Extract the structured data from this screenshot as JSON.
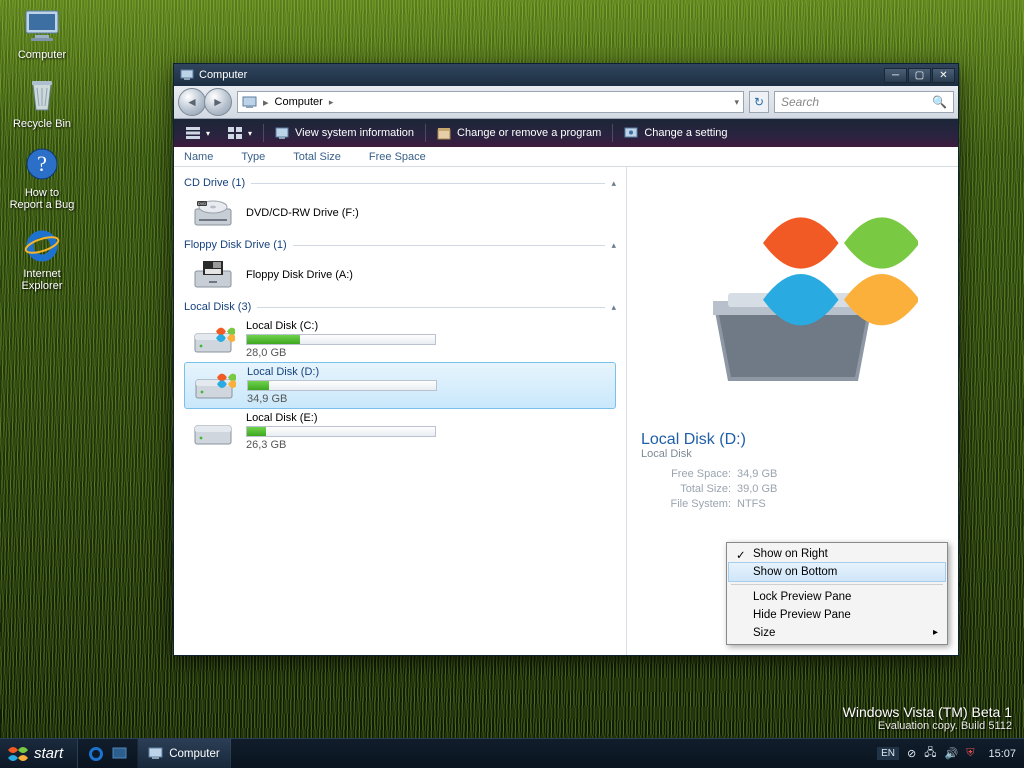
{
  "desktop": {
    "icons": [
      {
        "name": "computer-icon",
        "label": "Computer"
      },
      {
        "name": "recycle-bin-icon",
        "label": "Recycle Bin"
      },
      {
        "name": "help-icon",
        "label": "How to\nReport a Bug"
      },
      {
        "name": "ie-icon",
        "label": "Internet\nExplorer"
      }
    ]
  },
  "window": {
    "title": "Computer",
    "nav": {
      "back": "Back",
      "forward": "Forward"
    },
    "breadcrumb": {
      "crumb0": "Computer"
    },
    "search": {
      "placeholder": "Search"
    },
    "commands": {
      "organize_icon_label": "Organize",
      "views_icon_label": "Views",
      "view_system_info": "View system information",
      "change_remove": "Change or remove a program",
      "change_setting": "Change a setting"
    },
    "columns": {
      "c0": "Name",
      "c1": "Type",
      "c2": "Total Size",
      "c3": "Free Space"
    },
    "groups": {
      "cd_label": "CD Drive (1)",
      "cd_item_label": "DVD/CD-RW Drive (F:)",
      "floppy_label": "Floppy Disk Drive (1)",
      "floppy_item_label": "Floppy Disk Drive (A:)",
      "local_label": "Local Disk (3)",
      "disks": [
        {
          "name": "Local Disk (C:)",
          "cap": "28,0 GB",
          "fill": 28
        },
        {
          "name": "Local Disk (D:)",
          "cap": "34,9 GB",
          "fill": 11,
          "selected": true
        },
        {
          "name": "Local Disk (E:)",
          "cap": "26,3 GB",
          "fill": 10
        }
      ]
    },
    "preview": {
      "title": "Local Disk (D:)",
      "subtitle": "Local Disk",
      "free_k": "Free Space:",
      "free_v": "34,9 GB",
      "total_k": "Total Size:",
      "total_v": "39,0 GB",
      "fs_k": "File System:",
      "fs_v": "NTFS"
    },
    "context_menu": {
      "i0": "Show on Right",
      "i1": "Show on Bottom",
      "i2": "Lock Preview Pane",
      "i3": "Hide Preview Pane",
      "i4": "Size"
    }
  },
  "taskbar": {
    "start": "start",
    "app0": "Computer",
    "lang": "EN",
    "clock": "15:07"
  },
  "brand": {
    "l1": "Windows Vista (TM) Beta 1",
    "l2": "Evaluation copy. Build 5112"
  }
}
